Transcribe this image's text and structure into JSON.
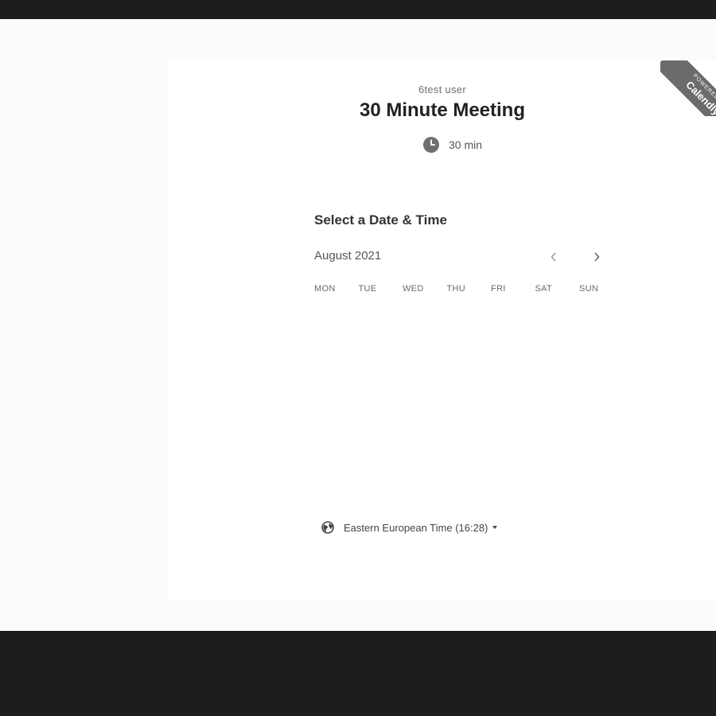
{
  "event": {
    "host": "6test user",
    "title": "30 Minute Meeting",
    "duration": "30 min"
  },
  "ribbon": {
    "small": "POWERED BY",
    "big": "Calendly"
  },
  "calendar": {
    "section_title": "Select a Date & Time",
    "month": "August 2021",
    "weekdays": [
      "MON",
      "TUE",
      "WED",
      "THU",
      "FRI",
      "SAT",
      "SUN"
    ]
  },
  "timezone": {
    "label": "Eastern European Time (16:28)"
  },
  "icons": {
    "duration": "clock-icon",
    "timezone": "globe-icon",
    "prev": "chevron-left-icon",
    "next": "chevron-right-icon",
    "dropdown": "caret-down-icon"
  },
  "colors": {
    "background": "#fbfbfb",
    "card": "#ffffff",
    "frame": "#1d1d1d",
    "ribbon": "#6b6b6b"
  }
}
